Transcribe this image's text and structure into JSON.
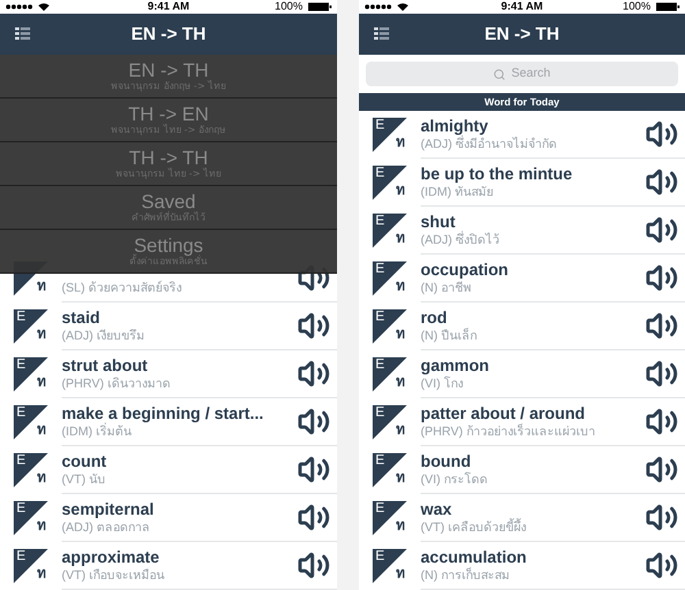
{
  "screens": [
    {
      "status_bar": {
        "time": "9:41 AM",
        "battery": "100%"
      },
      "nav": {
        "title": "EN -> TH"
      },
      "menu": {
        "items": [
          {
            "title": "EN -> TH",
            "subtitle": "พจนานุกรม อังกฤษ -> ไทย"
          },
          {
            "title": "TH -> EN",
            "subtitle": "พจนานุกรม ไทย -> อังกฤษ"
          },
          {
            "title": "TH -> TH",
            "subtitle": "พจนานุกรม ไทย -> ไทย"
          },
          {
            "title": "Saved",
            "subtitle": "คำศัพท์ที่บันทึกไว้"
          },
          {
            "title": "Settings",
            "subtitle": "ตั้งค่าแอพพลิเคชั่น"
          }
        ]
      },
      "words": [
        {
          "badge_bottom": "ท",
          "gloss": "(SL) ด้วยความสัตย์จริง"
        },
        {
          "badge_top": "E",
          "badge_bottom": "ท",
          "word": "staid",
          "gloss": "(ADJ) เงียบขรึม"
        },
        {
          "badge_top": "E",
          "badge_bottom": "ท",
          "word": "strut about",
          "gloss": "(PHRV) เดินวางมาด"
        },
        {
          "badge_top": "E",
          "badge_bottom": "ท",
          "word": "make a beginning / start...",
          "gloss": "(IDM) เริ่มต้น"
        },
        {
          "badge_top": "E",
          "badge_bottom": "ท",
          "word": "count",
          "gloss": "(VT) นับ"
        },
        {
          "badge_top": "E",
          "badge_bottom": "ท",
          "word": "sempiternal",
          "gloss": "(ADJ) ตลอดกาล"
        },
        {
          "badge_top": "E",
          "badge_bottom": "ท",
          "word": "approximate",
          "gloss": "(VT) เกือบจะเหมือน"
        }
      ]
    },
    {
      "status_bar": {
        "time": "9:41 AM",
        "battery": "100%"
      },
      "nav": {
        "title": "EN -> TH"
      },
      "search": {
        "placeholder": "Search"
      },
      "section_header": "Word for Today",
      "words": [
        {
          "badge_top": "E",
          "badge_bottom": "ท",
          "word": "almighty",
          "gloss": "(ADJ) ซึ่งมีอำนาจไม่จำกัด"
        },
        {
          "badge_top": "E",
          "badge_bottom": "ท",
          "word": "be up to the mintue",
          "gloss": "(IDM) ทันสมัย"
        },
        {
          "badge_top": "E",
          "badge_bottom": "ท",
          "word": "shut",
          "gloss": "(ADJ) ซึ่งปิดไว้"
        },
        {
          "badge_top": "E",
          "badge_bottom": "ท",
          "word": "occupation",
          "gloss": "(N) อาชีพ"
        },
        {
          "badge_top": "E",
          "badge_bottom": "ท",
          "word": "rod",
          "gloss": "(N) ปืนเล็ก"
        },
        {
          "badge_top": "E",
          "badge_bottom": "ท",
          "word": "gammon",
          "gloss": "(VI) โกง"
        },
        {
          "badge_top": "E",
          "badge_bottom": "ท",
          "word": "patter about / around",
          "gloss": "(PHRV) ก้าวอย่างเร็วและแผ่วเบา"
        },
        {
          "badge_top": "E",
          "badge_bottom": "ท",
          "word": "bound",
          "gloss": "(VI) กระโดด"
        },
        {
          "badge_top": "E",
          "badge_bottom": "ท",
          "word": "wax",
          "gloss": "(VT) เคลือบด้วยขี้ผึ้ง"
        },
        {
          "badge_top": "E",
          "badge_bottom": "ท",
          "word": "accumulation",
          "gloss": "(N) การเก็บสะสม"
        }
      ]
    }
  ]
}
